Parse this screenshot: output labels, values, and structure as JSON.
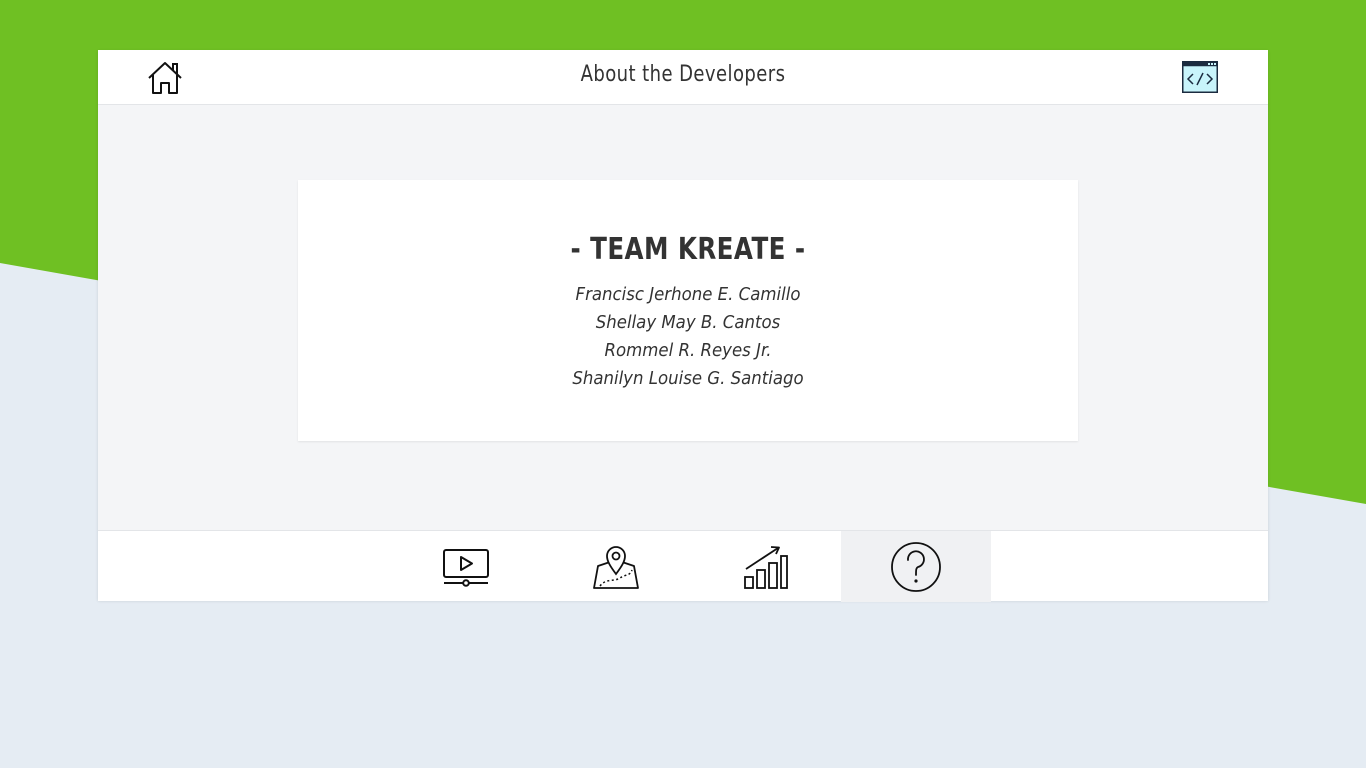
{
  "header": {
    "title": "About the Developers"
  },
  "team": {
    "name": "- TEAM KREATE -",
    "members": [
      "Francisc Jerhone E. Camillo",
      "Shellay May B. Cantos",
      "Rommel R. Reyes Jr.",
      "Shanilyn Louise G. Santiago"
    ]
  },
  "icons": {
    "home": "home-icon",
    "code": "code-window-icon",
    "nav": [
      "video-player-icon",
      "map-location-icon",
      "growth-chart-icon",
      "help-question-icon"
    ]
  },
  "colors": {
    "background_green": "#6fc023",
    "background_light": "#e5ecf3",
    "code_icon_fill": "#c8f4fb",
    "text": "#333333"
  },
  "footer": {
    "active_index": 3
  }
}
